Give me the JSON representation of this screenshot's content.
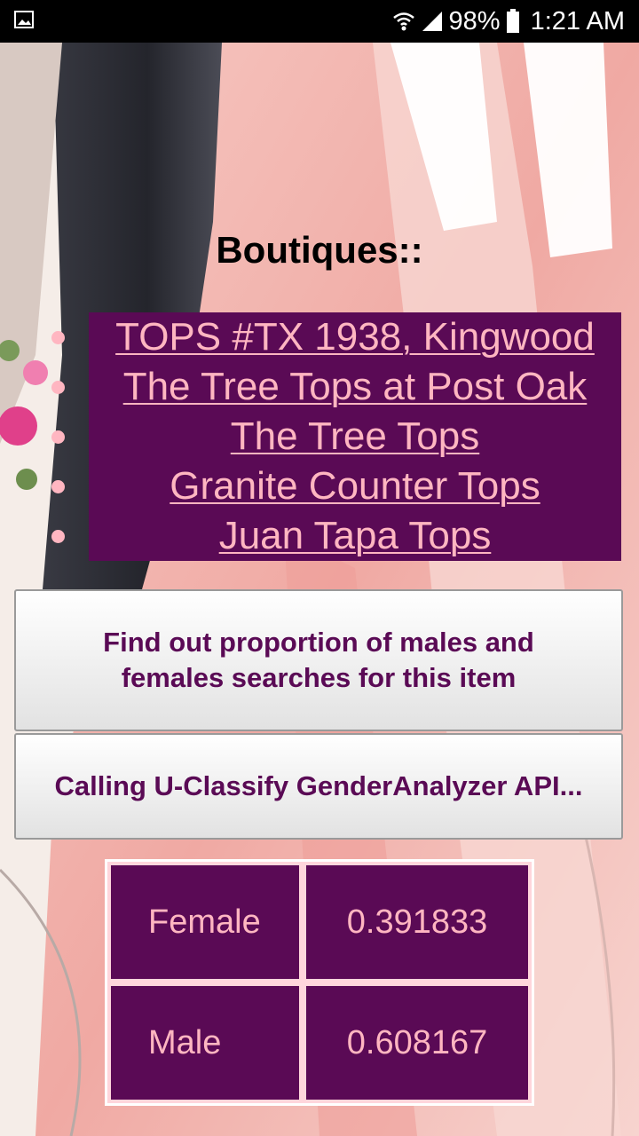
{
  "status_bar": {
    "battery": "98%",
    "time": "1:21 AM",
    "icons": [
      "image-icon",
      "wifi-icon",
      "signal-icon",
      "battery-icon"
    ]
  },
  "heading": "Boutiques::",
  "boutiques": [
    {
      "label": "TOPS #TX 1938, Kingwood"
    },
    {
      "label": "The Tree Tops at Post Oak"
    },
    {
      "label": "The Tree Tops"
    },
    {
      "label": "Granite Counter Tops"
    },
    {
      "label": "Juan Tapa Tops"
    }
  ],
  "buttons": {
    "find_label": "Find out proportion of males and females searches for this item",
    "call_label": "Calling U-Classify GenderAnalyzer API..."
  },
  "results": [
    {
      "label": "Female",
      "value": "0.391833"
    },
    {
      "label": "Male",
      "value": "0.608167"
    }
  ],
  "colors": {
    "accent": "#5a0a55",
    "link": "#ffb6c1",
    "status_bar": "#000000"
  }
}
